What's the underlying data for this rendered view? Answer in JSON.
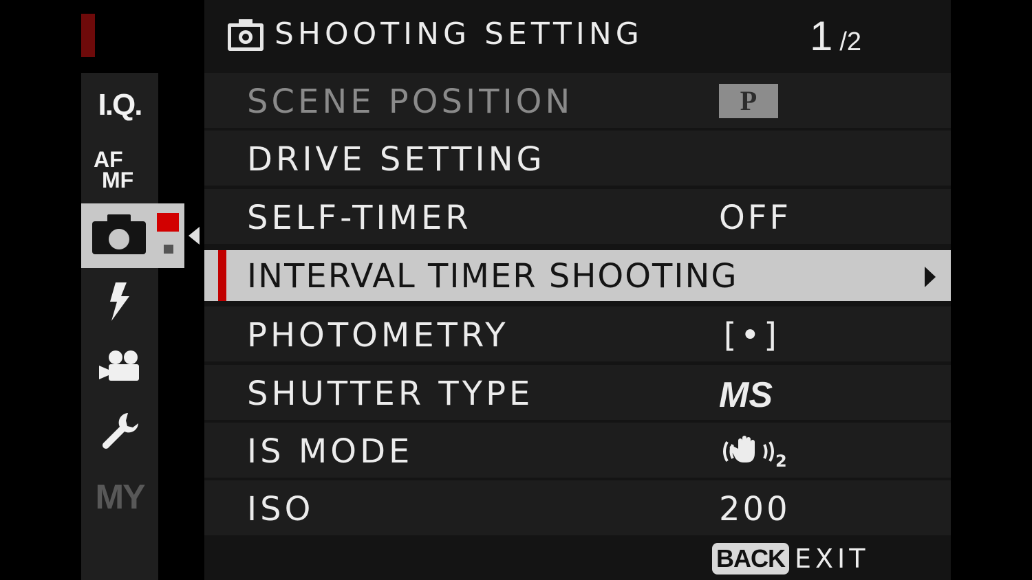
{
  "header": {
    "title": "SHOOTING SETTING",
    "page_current": "1",
    "page_total": "/2",
    "icon": "camera-icon"
  },
  "tabs": [
    {
      "name": "image-quality",
      "label": "I.Q."
    },
    {
      "name": "af-mf",
      "label_top": "AF",
      "label_bottom": "MF"
    },
    {
      "name": "shooting-setting",
      "icon": "camera-icon",
      "active": true
    },
    {
      "name": "flash",
      "icon": "flash-icon"
    },
    {
      "name": "movie",
      "icon": "movie-camera-icon"
    },
    {
      "name": "setup",
      "icon": "wrench-icon"
    },
    {
      "name": "my-menu",
      "label": "MY"
    }
  ],
  "menu": {
    "items": [
      {
        "label": "SCENE POSITION",
        "value": "P",
        "state": "disabled"
      },
      {
        "label": "DRIVE SETTING",
        "value": ""
      },
      {
        "label": "SELF-TIMER",
        "value": "OFF"
      },
      {
        "label": "INTERVAL TIMER SHOOTING",
        "value": "",
        "state": "selected"
      },
      {
        "label": "PHOTOMETRY",
        "value": "[•]",
        "value_icon": "spot-metering-icon"
      },
      {
        "label": "SHUTTER TYPE",
        "value": "MS"
      },
      {
        "label": "IS MODE",
        "value": "",
        "value_icon": "image-stabilization-mode-2-icon"
      },
      {
        "label": "ISO",
        "value": "200"
      }
    ]
  },
  "footer": {
    "back_label": "BACK",
    "exit_label": "EXIT"
  },
  "colors": {
    "accent_red": "#c10000",
    "selected_bg": "#c9c9c9",
    "row_bg": "#1d1d1d"
  }
}
